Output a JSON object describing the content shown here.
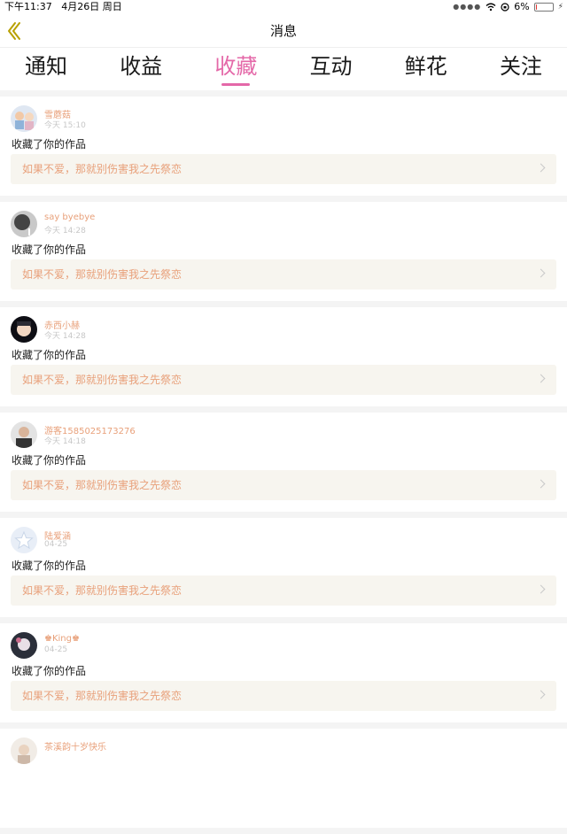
{
  "status_bar": {
    "time": "下午11:37",
    "date": "4月26日 周日",
    "battery_percent": "6%",
    "battery_level": 0.06,
    "battery_color": "#e53935"
  },
  "nav": {
    "title": "消息",
    "back_icon": "chevron-left-icon"
  },
  "tabs": [
    {
      "label": "通知",
      "active": false
    },
    {
      "label": "收益",
      "active": false
    },
    {
      "label": "收藏",
      "active": true
    },
    {
      "label": "互动",
      "active": false
    },
    {
      "label": "鲜花",
      "active": false
    },
    {
      "label": "关注",
      "active": false
    }
  ],
  "colors": {
    "accent": "#e468a8",
    "username": "#e8a07a",
    "work_bg": "#f7f5ef"
  },
  "messages": [
    {
      "username": "雪蘑菇",
      "time": "今天 15:10",
      "action": "收藏了你的作品",
      "work_title": "如果不爱，那就别伤害我之先祭恋"
    },
    {
      "username": "say byebye",
      "time": "今天 14:28",
      "action": "收藏了你的作品",
      "work_title": "如果不爱，那就别伤害我之先祭恋"
    },
    {
      "username": "赤西小赫",
      "time": "今天 14:28",
      "action": "收藏了你的作品",
      "work_title": "如果不爱，那就别伤害我之先祭恋"
    },
    {
      "username": "游客1585025173276",
      "time": "今天 14:18",
      "action": "收藏了你的作品",
      "work_title": "如果不爱，那就别伤害我之先祭恋"
    },
    {
      "username": "陆爱涵",
      "time": "04-25",
      "action": "收藏了你的作品",
      "work_title": "如果不爱，那就别伤害我之先祭恋"
    },
    {
      "username": "♚King♚",
      "time": "04-25",
      "action": "收藏了你的作品",
      "work_title": "如果不爱，那就别伤害我之先祭恋"
    },
    {
      "username": "茶溪韵十岁快乐",
      "time": "",
      "action": "",
      "work_title": ""
    }
  ]
}
